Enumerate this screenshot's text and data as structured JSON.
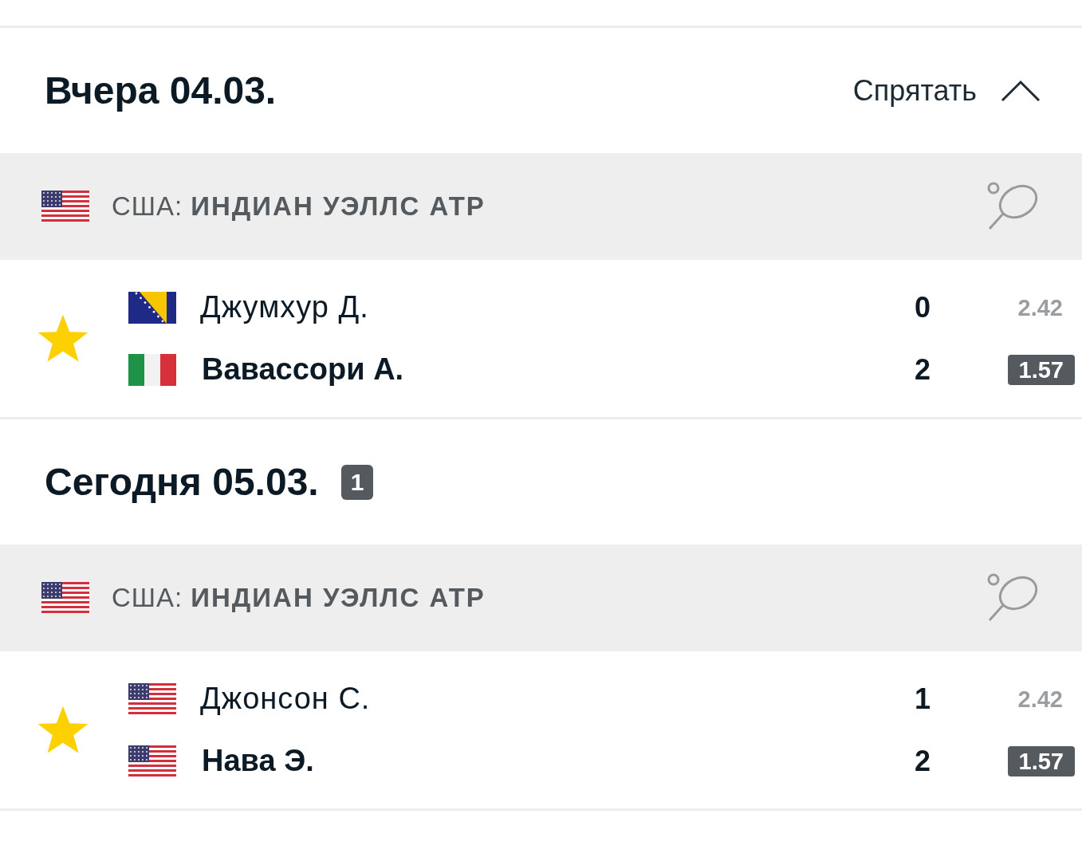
{
  "sections": [
    {
      "title": "Вчера 04.03.",
      "toggle_label": "Спрятать",
      "expanded": true,
      "league": {
        "flag": {
          "kind": "us"
        },
        "country": "США:",
        "name": "ИНДИАН УЭЛЛС АТР"
      },
      "matches": [
        {
          "favorite": true,
          "players": [
            {
              "flag": {
                "kind": "ba"
              },
              "name": "Джумхур Д.",
              "score": "0",
              "odd": "2.42",
              "winner": false
            },
            {
              "flag": {
                "kind": "it"
              },
              "name": "Вавассори А.",
              "score": "2",
              "odd": "1.57",
              "winner": true
            }
          ]
        }
      ]
    },
    {
      "title": "Сегодня 05.03.",
      "badge": "1",
      "league": {
        "flag": {
          "kind": "us"
        },
        "country": "США:",
        "name": "ИНДИАН УЭЛЛС АТР"
      },
      "matches": [
        {
          "favorite": true,
          "players": [
            {
              "flag": {
                "kind": "us"
              },
              "name": "Джонсон С.",
              "score": "1",
              "odd": "2.42",
              "winner": false
            },
            {
              "flag": {
                "kind": "us"
              },
              "name": "Нава Э.",
              "score": "2",
              "odd": "1.57",
              "winner": true
            }
          ]
        }
      ]
    }
  ]
}
